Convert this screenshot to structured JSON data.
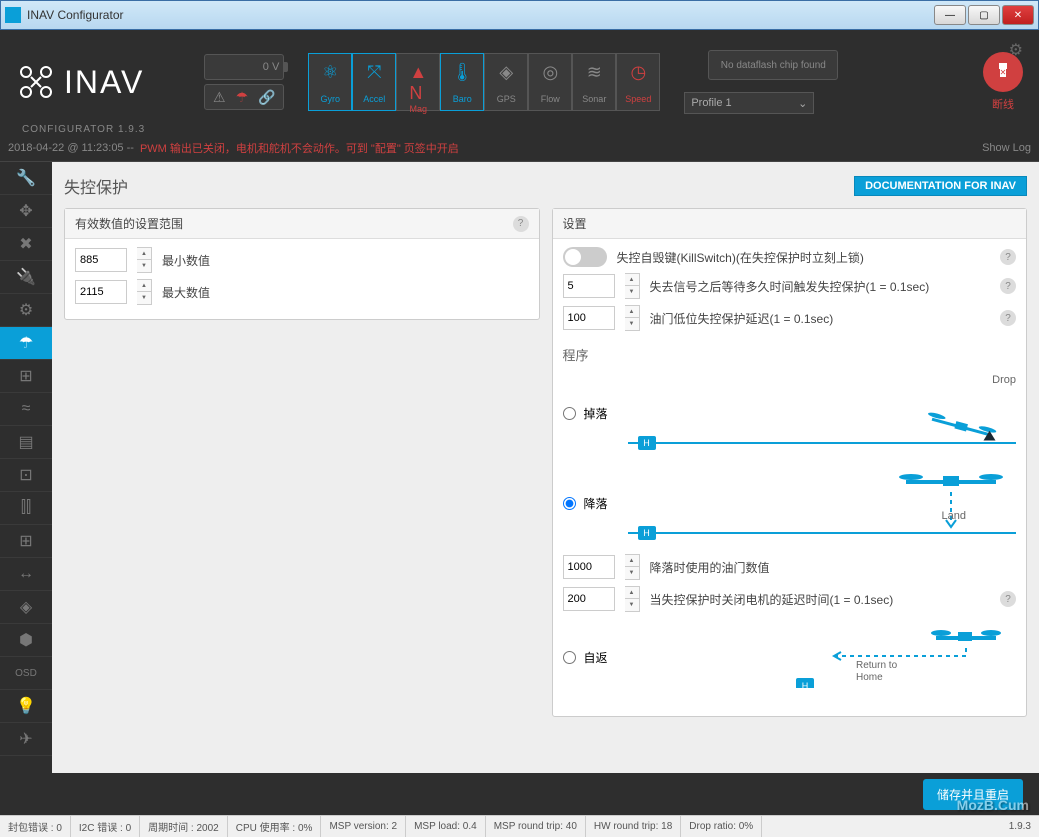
{
  "window": {
    "title": "INAV Configurator"
  },
  "app": {
    "name": "INAV",
    "subtitle": "CONFIGURATOR  1.9.3"
  },
  "battery": {
    "voltage": "0 V"
  },
  "warn_icons": {
    "warning": "▲",
    "parachute": "✦",
    "link": "∞"
  },
  "sensors": [
    {
      "name": "Gyro",
      "icon": "⚛",
      "state": "ok"
    },
    {
      "name": "Accel",
      "icon": "↕",
      "state": "ok"
    },
    {
      "name": "Mag",
      "icon": "N",
      "state": "bad"
    },
    {
      "name": "Baro",
      "icon": "🌡",
      "state": "ok"
    },
    {
      "name": "GPS",
      "icon": "◈",
      "state": "off"
    },
    {
      "name": "Flow",
      "icon": "◎",
      "state": "off"
    },
    {
      "name": "Sonar",
      "icon": "≋",
      "state": "off"
    },
    {
      "name": "Speed",
      "icon": "◷",
      "state": "bad"
    }
  ],
  "dataflash": {
    "text": "No dataflash chip found"
  },
  "profile": {
    "selected": "Profile 1"
  },
  "connect": {
    "label": "断线"
  },
  "log": {
    "timestamp": "2018-04-22 @ 11:23:05 --",
    "message": "PWM 输出已关闭，电机和舵机不会动作。可到 \"配置\" 页签中开启",
    "showlog": "Show Log"
  },
  "page": {
    "title": "失控保护",
    "doc_link": "DOCUMENTATION FOR INAV"
  },
  "valid_range": {
    "header": "有效数值的设置范围",
    "min_label": "最小数值",
    "min_value": "885",
    "max_label": "最大数值",
    "max_value": "2115"
  },
  "settings": {
    "header": "设置",
    "killswitch_label": "失控自毁键(KillSwitch)(在失控保护时立刻上锁)",
    "delay_value": "5",
    "delay_label": "失去信号之后等待多久时间触发失控保护(1 = 0.1sec)",
    "throttle_value": "100",
    "throttle_label": "油门低位失控保护延迟(1 = 0.1sec)"
  },
  "procedure": {
    "header": "程序",
    "drop": {
      "label": "掉落",
      "img_label": "Drop"
    },
    "land": {
      "label": "降落",
      "img_label": "Land"
    },
    "throttle_value": "1000",
    "throttle_label": "降落时使用的油门数值",
    "offdelay_value": "200",
    "offdelay_label": "当失控保护时关闭电机的延迟时间(1 = 0.1sec)",
    "rth": {
      "label": "自返",
      "img_label": "Return to Home"
    }
  },
  "save": {
    "label": "储存并且重启"
  },
  "status": {
    "packet_err": "封包错误 : 0",
    "i2c_err": "I2C 错误 : 0",
    "cycle": "周期时间 : 2002",
    "cpu": "CPU 使用率 : 0%",
    "msp_ver": "MSP version: 2",
    "msp_load": "MSP load: 0.4",
    "msp_rt": "MSP round trip: 40",
    "hw_rt": "HW round trip: 18",
    "drop": "Drop ratio: 0%",
    "ver": "1.9.3"
  },
  "watermark": "MozB.Cum"
}
